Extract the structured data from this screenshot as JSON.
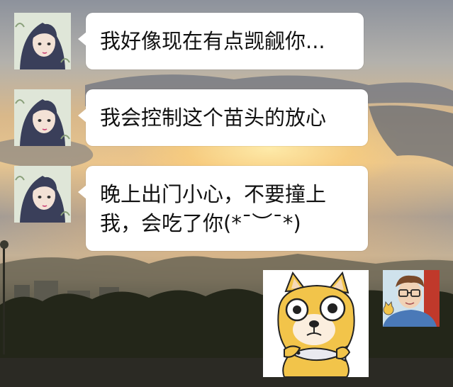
{
  "chat": {
    "messages": [
      {
        "sender": "contact",
        "avatar": "girl-avatar-icon",
        "text": "我好像现在有点觊觎你..."
      },
      {
        "sender": "contact",
        "avatar": "girl-avatar-icon",
        "text": "我会控制这个苗头的放心"
      },
      {
        "sender": "contact",
        "avatar": "girl-avatar-icon",
        "text_line1": "晚上出门小心，不要撞上",
        "text_line2": "我，会吃了你(*¯︶¯*)"
      },
      {
        "sender": "me",
        "avatar": "man-glasses-avatar-icon",
        "sticker": "shocked-doge-sticker-icon"
      }
    ]
  },
  "colors": {
    "bubble": "#ffffff",
    "text": "#111111",
    "sky_glow": "#e8c690",
    "ground": "#1b1d14"
  }
}
